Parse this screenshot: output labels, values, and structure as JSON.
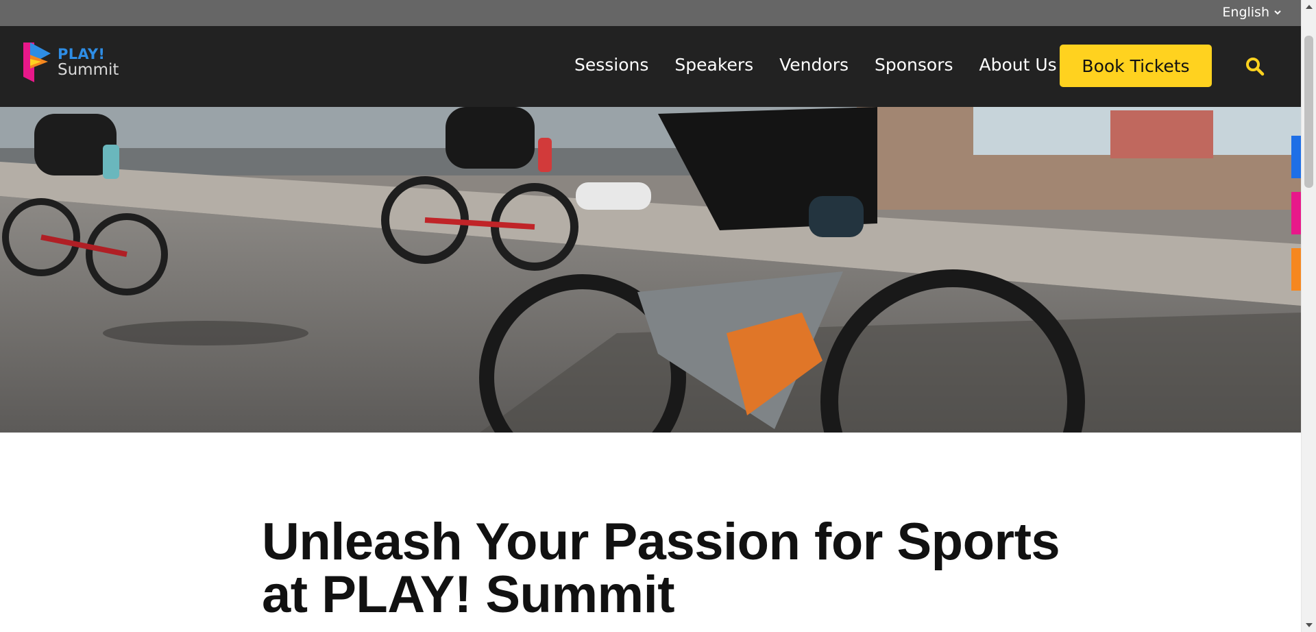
{
  "language": {
    "label": "English",
    "icon": "chevron-down-icon"
  },
  "logo": {
    "line1": "PLAY!",
    "line2": "Summit"
  },
  "nav": {
    "items": [
      {
        "label": "Sessions"
      },
      {
        "label": "Speakers"
      },
      {
        "label": "Vendors"
      },
      {
        "label": "Sponsors"
      },
      {
        "label": "About Us"
      }
    ],
    "book_label": "Book Tickets",
    "search_icon": "search-icon"
  },
  "hero": {
    "image": "cyclists-racing-photo"
  },
  "side_tabs": {
    "colors": [
      "#1e6fe6",
      "#e8188a",
      "#f5871f"
    ]
  },
  "headline": {
    "line1": "Unleash Your Passion for Sports",
    "line2": "at PLAY! Summit"
  },
  "colors": {
    "accent": "#ffd21f",
    "header_bg": "#222222",
    "topbar_bg": "#666666",
    "brand_blue": "#2e8de5"
  }
}
